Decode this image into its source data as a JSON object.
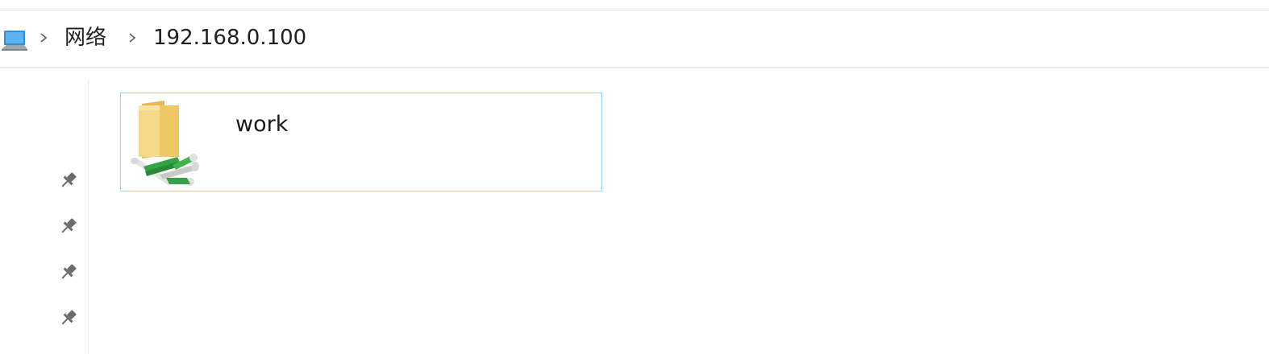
{
  "address_bar": {
    "root_icon": "this-pc-icon",
    "separator_icon": "chevron-right-icon",
    "crumbs": [
      "网络",
      "192.168.0.100"
    ]
  },
  "quick_access": {
    "pin_icon": "pin-icon",
    "pin_count": 4
  },
  "items": [
    {
      "name": "work",
      "icon": "network-share-folder-icon",
      "state": "hover"
    }
  ],
  "colors": {
    "selection_border": "#99d1ff",
    "folder": "#f3d37d",
    "pipe": "#33a845",
    "pin": "#6b6b6b"
  }
}
